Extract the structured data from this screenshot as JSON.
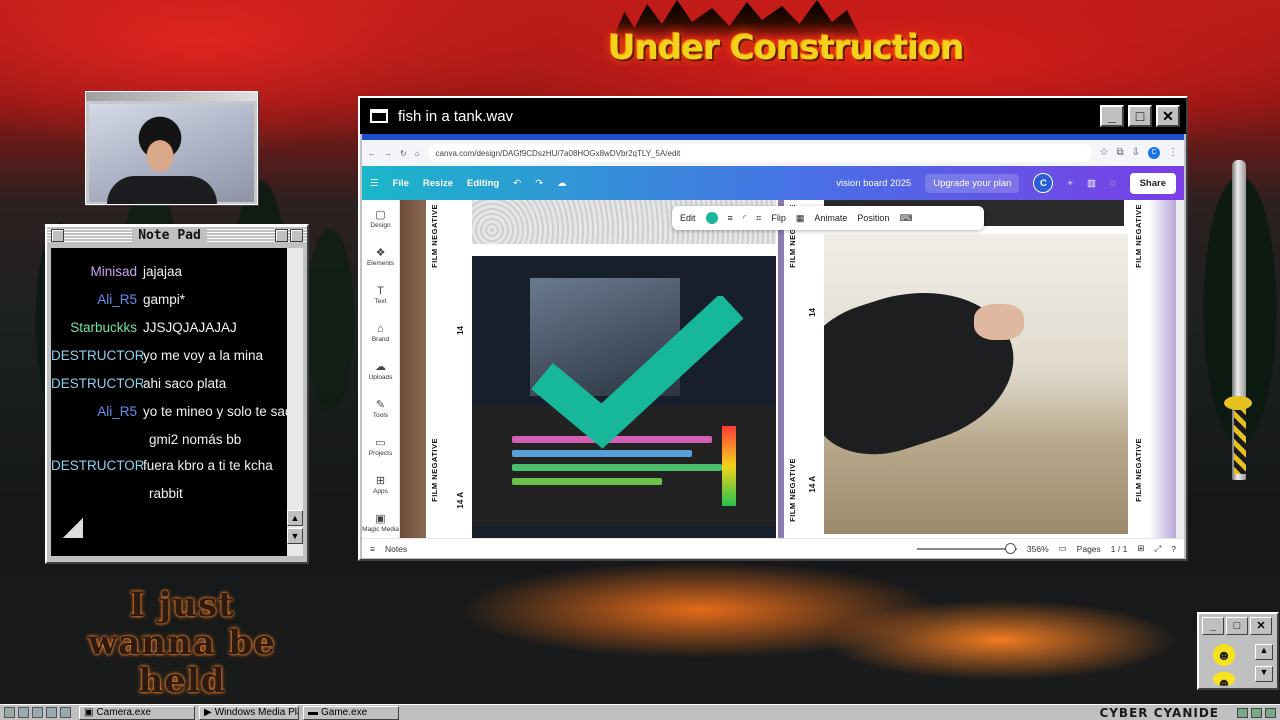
{
  "background": {
    "banner_text": "Under Construction",
    "quote": "I just wanna be held"
  },
  "notepad": {
    "title": "Note Pad",
    "messages": [
      {
        "user": "Minisad",
        "text": "jajajaa",
        "color": "#c9a3ee"
      },
      {
        "user": "Ali_R5",
        "text": "gampi*",
        "color": "#5f8ff0"
      },
      {
        "user": "Starbuckks",
        "text": "JJSJQJAJAJAJ",
        "color": "#6de3b0"
      },
      {
        "user": "DESTRUCTOR...",
        "text": "yo me voy a la mina",
        "color": "#8ad0f0"
      },
      {
        "user": "DESTRUCTOR...",
        "text": "ahi saco plata",
        "color": "#8ad0f0"
      },
      {
        "user": "Ali_R5",
        "text": "yo te mineo y solo te saco",
        "color": "#5f8ff0"
      },
      {
        "user": "",
        "text": "gmi2 nomás bb",
        "color": "#fff"
      },
      {
        "user": "DESTRUCTOR...",
        "text": "fuera kbro a ti te kcha",
        "color": "#8ad0f0"
      },
      {
        "user": "",
        "text": "rabbit",
        "color": "#fff"
      }
    ]
  },
  "window": {
    "title": "fish in a tank.wav",
    "url": "canva.com/design/DAGf9CDszHU/7a08HOGx8wDVbr2qTLY_5A/edit",
    "canva": {
      "file": "File",
      "resize": "Resize",
      "editing": "Editing",
      "doc_name": "vision board 2025",
      "upgrade": "Upgrade your plan",
      "avatar": "C",
      "share": "Share"
    },
    "sidebar": [
      {
        "label": "Design",
        "icon": "▢"
      },
      {
        "label": "Elements",
        "icon": "❖"
      },
      {
        "label": "Text",
        "icon": "T"
      },
      {
        "label": "Brand",
        "icon": "⌂"
      },
      {
        "label": "Uploads",
        "icon": "☁"
      },
      {
        "label": "Tools",
        "icon": "✎"
      },
      {
        "label": "Projects",
        "icon": "▭"
      },
      {
        "label": "Apps",
        "icon": "⊞"
      },
      {
        "label": "Magic Media",
        "icon": "▣"
      }
    ],
    "toolbar": {
      "edit": "Edit",
      "flip": "Flip",
      "animate": "Animate",
      "position": "Position"
    },
    "film": {
      "label": "FILM NEGATIVE",
      "num_a": "14",
      "num_b": "14 A"
    },
    "footer": {
      "notes": "Notes",
      "zoom": "356%",
      "pages": "Pages",
      "page_count": "1 / 1"
    }
  },
  "taskbar": {
    "tasks": [
      "Camera.exe",
      "Windows Media Pla",
      "Game.exe"
    ],
    "brand": "CYBER CYANIDE"
  }
}
